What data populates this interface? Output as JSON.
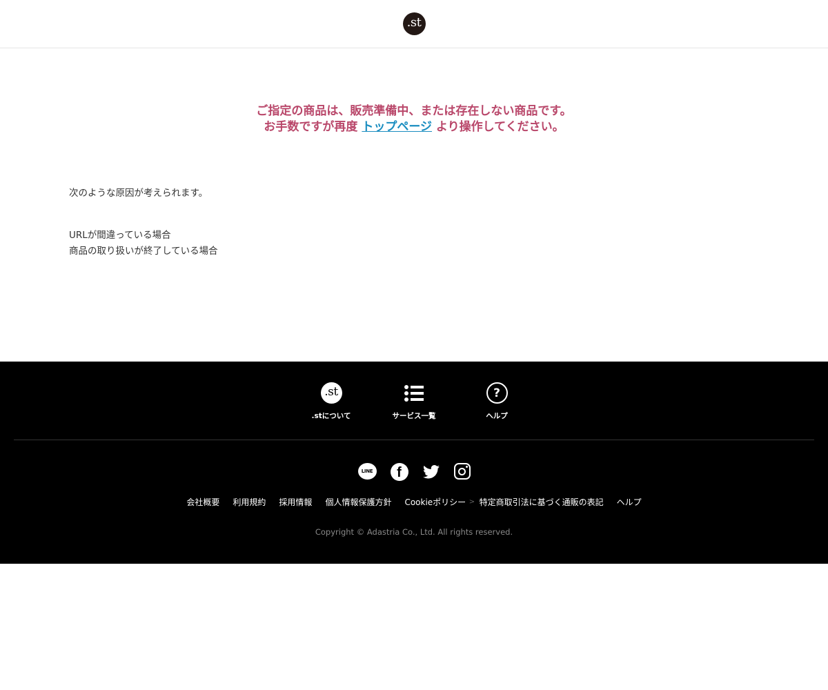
{
  "header": {
    "logo_text": ".st"
  },
  "error": {
    "line1": "ご指定の商品は、販売準備中、または存在しない商品です。",
    "line2_before": "お手数ですが再度 ",
    "line2_link": "トップページ",
    "line2_after": " より操作してください。",
    "link_color": "#1a8dc0",
    "text_color": "#b9476a"
  },
  "causes": {
    "intro": "次のような原因が考えられます。",
    "items": [
      "URLが間違っている場合",
      "商品の取り扱いが終了している場合"
    ]
  },
  "footer": {
    "nav": [
      {
        "label": ".stについて",
        "icon": "st-logo-icon",
        "icon_text": ".st"
      },
      {
        "label": "サービス一覧",
        "icon": "list-icon"
      },
      {
        "label": "ヘルプ",
        "icon": "help-icon",
        "icon_text": "?"
      }
    ],
    "social": [
      {
        "name": "line-icon",
        "text": "LINE"
      },
      {
        "name": "facebook-icon",
        "text": "f"
      },
      {
        "name": "twitter-icon"
      },
      {
        "name": "instagram-icon"
      }
    ],
    "links": [
      "会社概要",
      "利用規約",
      "採用情報",
      "個人情報保護方針",
      "Cookieポリシー",
      "特定商取引法に基づく通販の表記",
      "ヘルプ"
    ],
    "separator": ">",
    "copyright": "Copyright © Adastria Co., Ltd. All rights reserved."
  }
}
